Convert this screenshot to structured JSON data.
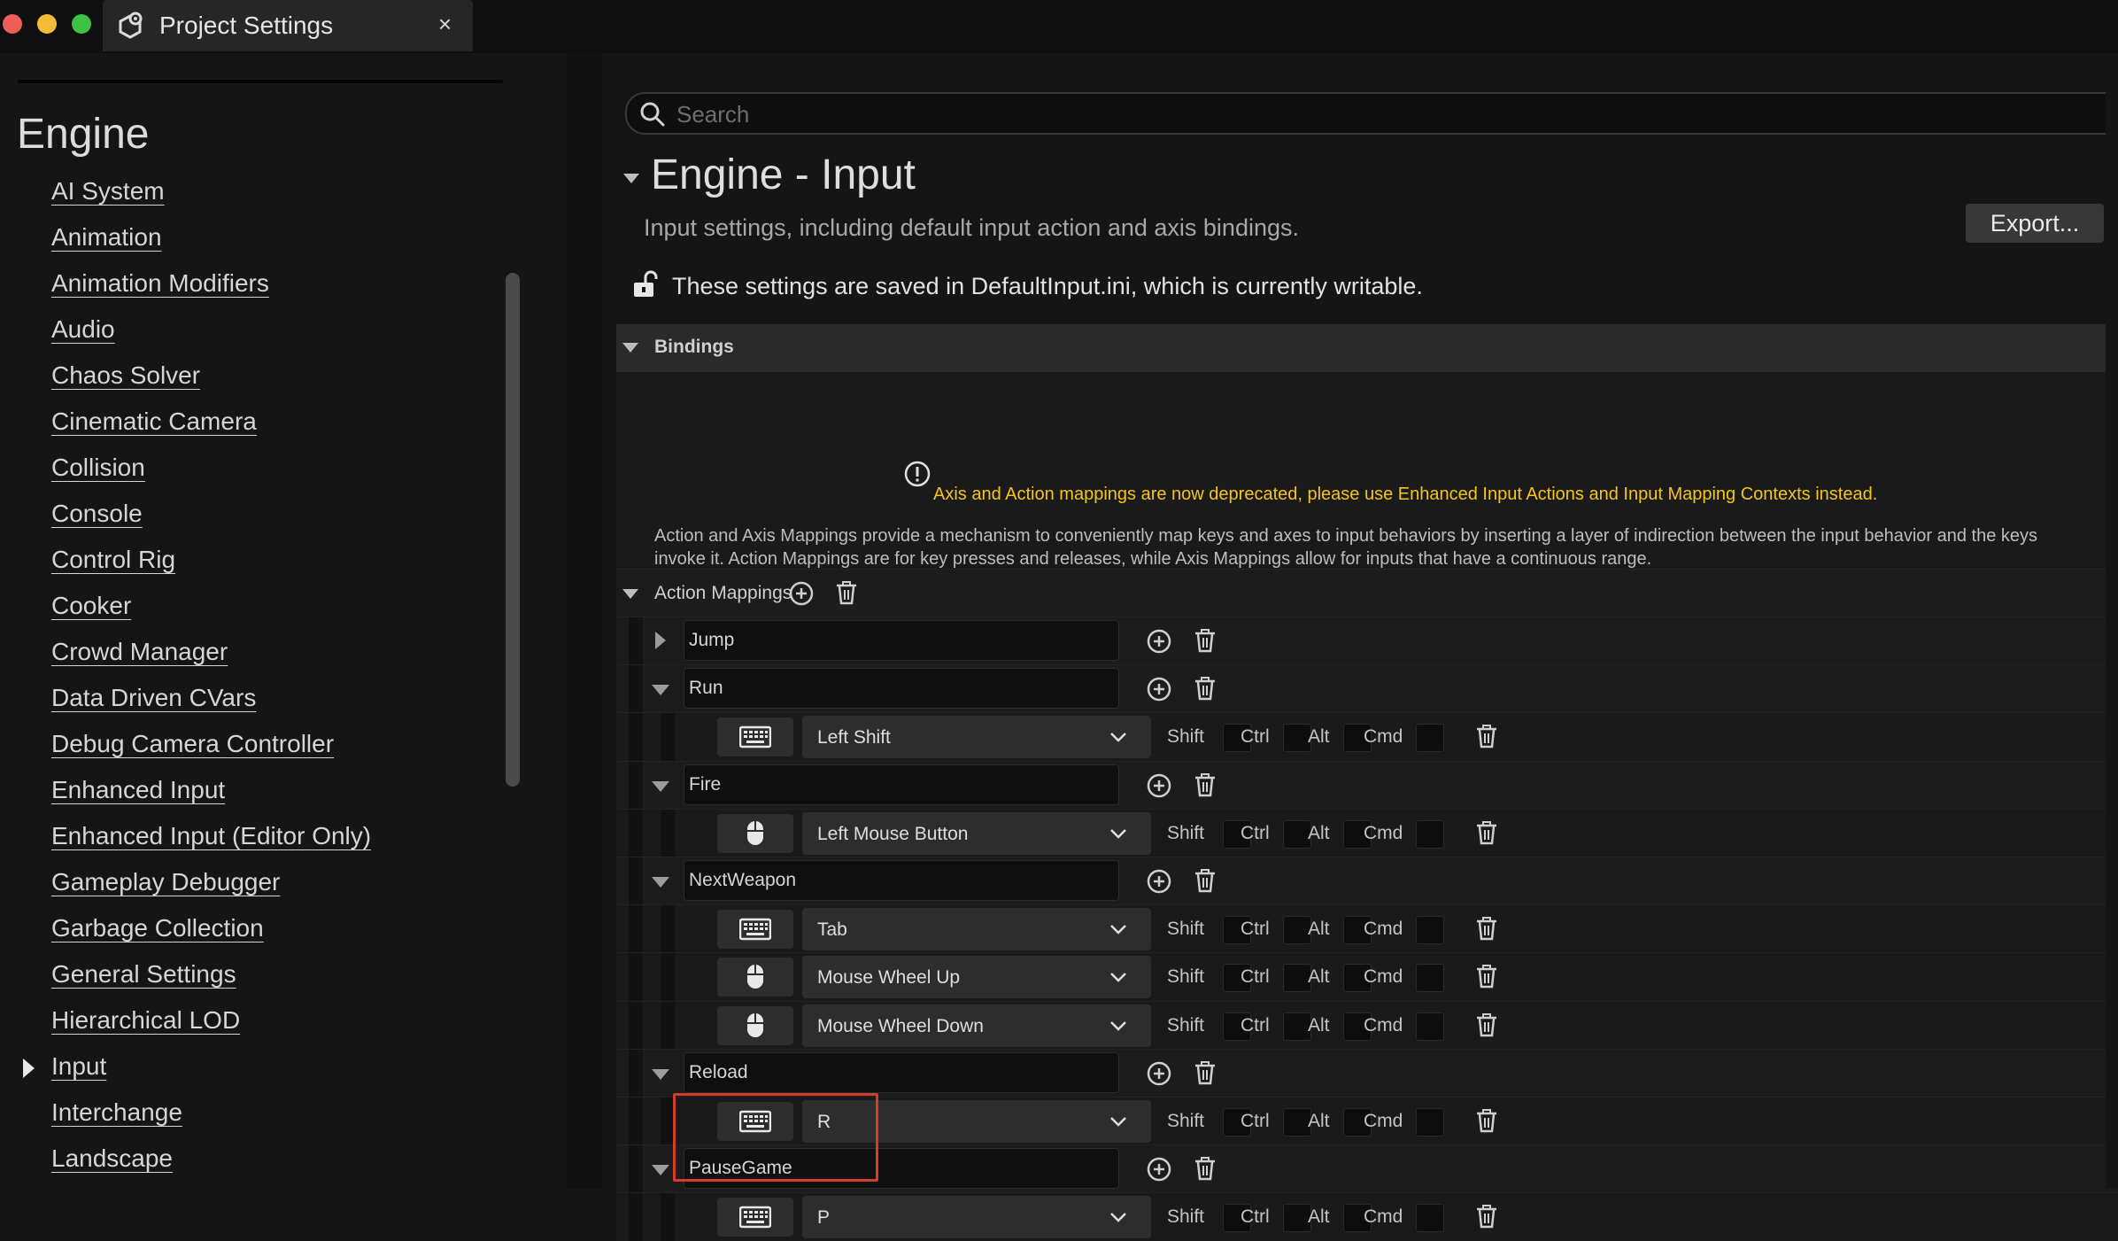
{
  "window": {
    "tab_title": "Project Settings",
    "tab_close": "×"
  },
  "sidebar": {
    "heading": "Engine",
    "selected": "Input",
    "items": [
      "AI System",
      "Animation",
      "Animation Modifiers",
      "Audio",
      "Chaos Solver",
      "Cinematic Camera",
      "Collision",
      "Console",
      "Control Rig",
      "Cooker",
      "Crowd Manager",
      "Data Driven CVars",
      "Debug Camera Controller",
      "Enhanced Input",
      "Enhanced Input (Editor Only)",
      "Gameplay Debugger",
      "Garbage Collection",
      "General Settings",
      "Hierarchical LOD",
      "Input",
      "Interchange",
      "Landscape"
    ]
  },
  "search": {
    "placeholder": "Search",
    "value": ""
  },
  "main": {
    "title": "Engine - Input",
    "description": "Input settings, including default input action and axis bindings.",
    "export_label": "Export...",
    "writable_note": "These settings are saved in DefaultInput.ini, which is currently writable.",
    "bindings_label": "Bindings",
    "warning": "Axis and Action mappings are now deprecated, please use Enhanced Input Actions and Input Mapping Contexts instead.",
    "info_line1": "Action and Axis Mappings provide a mechanism to conveniently map keys and axes to input behaviors by inserting a layer of indirection between the input behavior and the keys",
    "info_line2": "invoke it. Action Mappings are for key presses and releases, while Axis Mappings allow for inputs that have a continuous range.",
    "action_mappings_label": "Action Mappings"
  },
  "modifiers": [
    "Shift",
    "Ctrl",
    "Alt",
    "Cmd"
  ],
  "actions": [
    {
      "name": "Jump",
      "expanded": false,
      "keys": []
    },
    {
      "name": "Run",
      "expanded": true,
      "keys": [
        {
          "device": "keyboard-icon",
          "key": "Left Shift"
        }
      ]
    },
    {
      "name": "Fire",
      "expanded": true,
      "keys": [
        {
          "device": "mouse-icon",
          "key": "Left Mouse Button"
        }
      ]
    },
    {
      "name": "NextWeapon",
      "expanded": true,
      "keys": [
        {
          "device": "keyboard-icon",
          "key": "Tab"
        },
        {
          "device": "mouse-icon",
          "key": "Mouse Wheel Up"
        },
        {
          "device": "mouse-icon",
          "key": "Mouse Wheel Down"
        }
      ]
    },
    {
      "name": "Reload",
      "expanded": true,
      "keys": [
        {
          "device": "keyboard-icon",
          "key": "R"
        }
      ]
    },
    {
      "name": "PauseGame",
      "expanded": true,
      "keys": [
        {
          "device": "keyboard-icon",
          "key": "P"
        }
      ]
    }
  ],
  "colors": {
    "accent_warning": "#f5c518",
    "highlight_box": "#d43c2e",
    "background": "#151515"
  }
}
